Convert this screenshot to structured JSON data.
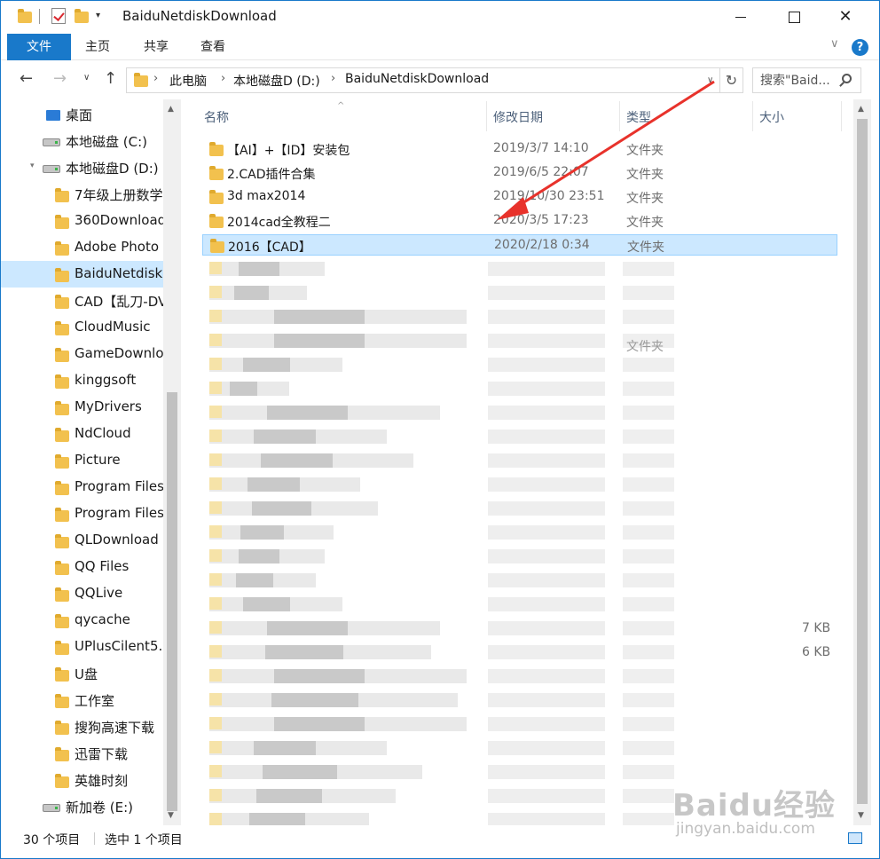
{
  "window": {
    "title": "BaiduNetdiskDownload",
    "quick_access_dropdown": "▾",
    "minimize": "",
    "maximize": "",
    "close": "✕"
  },
  "ribbon": {
    "tabs": [
      {
        "label": "文件"
      },
      {
        "label": "主页"
      },
      {
        "label": "共享"
      },
      {
        "label": "查看"
      }
    ],
    "expand_icon": "∨",
    "help_icon": "?"
  },
  "address": {
    "back": "←",
    "forward": "→",
    "recent": "∨",
    "up": "↑",
    "crumbs": [
      "此电脑",
      "本地磁盘D (D:)",
      "BaiduNetdiskDownload"
    ],
    "separator": "›",
    "dropdown": "∨",
    "refresh": "↻",
    "search_placeholder": "搜索\"Baid..."
  },
  "nav_pane": {
    "items": [
      {
        "label": "桌面",
        "kind": "desktop"
      },
      {
        "label": "本地磁盘 (C:)",
        "kind": "drive"
      },
      {
        "label": "本地磁盘D (D:)",
        "kind": "drive",
        "expanded": true
      },
      {
        "label": "7年级上册数学",
        "kind": "folder"
      },
      {
        "label": "360Download",
        "kind": "folder"
      },
      {
        "label": "Adobe Photo",
        "kind": "folder"
      },
      {
        "label": "BaiduNetdiskI",
        "kind": "folder",
        "selected": true
      },
      {
        "label": "CAD【乱刀-DV",
        "kind": "folder"
      },
      {
        "label": "CloudMusic",
        "kind": "folder"
      },
      {
        "label": "GameDownlo",
        "kind": "folder"
      },
      {
        "label": "kinggsoft",
        "kind": "folder"
      },
      {
        "label": "MyDrivers",
        "kind": "folder"
      },
      {
        "label": "NdCloud",
        "kind": "folder"
      },
      {
        "label": "Picture",
        "kind": "folder"
      },
      {
        "label": "Program Files",
        "kind": "folder"
      },
      {
        "label": "Program Files",
        "kind": "folder"
      },
      {
        "label": "QLDownload",
        "kind": "folder"
      },
      {
        "label": "QQ Files",
        "kind": "folder"
      },
      {
        "label": "QQLive",
        "kind": "folder"
      },
      {
        "label": "qycache",
        "kind": "folder"
      },
      {
        "label": "UPlusCilent5.(",
        "kind": "folder"
      },
      {
        "label": "U盘",
        "kind": "folder"
      },
      {
        "label": "工作室",
        "kind": "folder"
      },
      {
        "label": "搜狗高速下载",
        "kind": "folder"
      },
      {
        "label": "迅雷下载",
        "kind": "folder"
      },
      {
        "label": "英雄时刻",
        "kind": "folder"
      },
      {
        "label": "新加卷 (E:)",
        "kind": "drive"
      }
    ]
  },
  "file_list": {
    "columns": {
      "name": "名称",
      "date": "修改日期",
      "type": "类型",
      "size": "大小"
    },
    "sort_indicator": "^",
    "rows": [
      {
        "name": "【AI】+【ID】安装包",
        "date": "2019/3/7 14:10",
        "type": "文件夹"
      },
      {
        "name": "2.CAD插件合集",
        "date": "2019/6/5 22:07",
        "type": "文件夹"
      },
      {
        "name": "3d max2014",
        "date": "2019/10/30 23:51",
        "type": "文件夹"
      },
      {
        "name": "2014cad全教程二",
        "date": "2020/3/5 17:23",
        "type": "文件夹"
      },
      {
        "name": "2016【CAD】",
        "date": "2020/2/18 0:34",
        "type": "文件夹",
        "selected": true
      }
    ],
    "partial_type_label": "文件夹",
    "partial_sizes": [
      "7 KB",
      "6 KB"
    ]
  },
  "status": {
    "count": "30 个项目",
    "selected": "选中 1 个项目"
  },
  "watermark": {
    "brand": "Baidu经验",
    "url": "jingyan.baidu.com"
  },
  "colors": {
    "accent": "#1979ca",
    "selection": "#cce8ff",
    "annotation_arrow": "#e8322b",
    "folder": "#f2c14e"
  }
}
